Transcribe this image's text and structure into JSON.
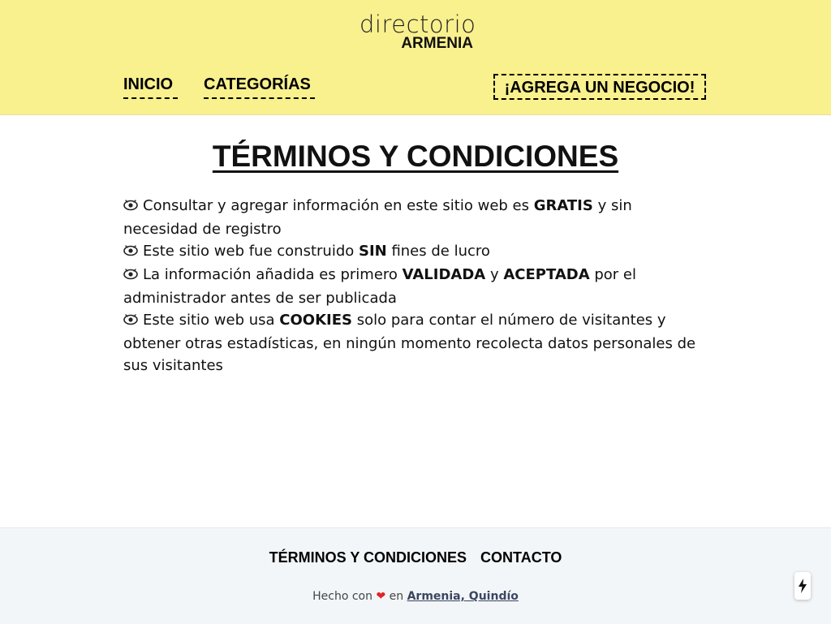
{
  "header": {
    "logo": {
      "top": "directorio",
      "bottom": "ARMENIA"
    },
    "nav": {
      "inicio": "INICIO",
      "categorias": "CATEGORÍAS"
    },
    "cta": "¡AGREGA UN NEGOCIO!",
    "background_color": "#f9f08e"
  },
  "main": {
    "title": "TÉRMINOS Y CONDICIONES",
    "items": [
      {
        "parts": [
          {
            "text": "Consultar y agregar información en este sitio web es ",
            "bold": false
          },
          {
            "text": "GRATIS",
            "bold": true
          },
          {
            "text": " y sin necesidad de registro",
            "bold": false
          }
        ]
      },
      {
        "parts": [
          {
            "text": "Este sitio web fue construido ",
            "bold": false
          },
          {
            "text": "SIN",
            "bold": true
          },
          {
            "text": " fines de lucro",
            "bold": false
          }
        ]
      },
      {
        "parts": [
          {
            "text": "La información añadida es primero ",
            "bold": false
          },
          {
            "text": "VALIDADA",
            "bold": true
          },
          {
            "text": " y ",
            "bold": false
          },
          {
            "text": "ACEPTADA",
            "bold": true
          },
          {
            "text": " por el administrador antes de ser publicada",
            "bold": false
          }
        ]
      },
      {
        "parts": [
          {
            "text": "Este sitio web usa ",
            "bold": false
          },
          {
            "text": "COOKIES",
            "bold": true
          },
          {
            "text": " solo para contar el número de visitantes y obtener otras estadísticas, en ningún momento recolecta datos personales de sus visitantes",
            "bold": false
          }
        ]
      }
    ],
    "bullet_icon": "eye-icon"
  },
  "footer": {
    "links": {
      "terms": "TÉRMINOS Y CONDICIONES",
      "contact": "CONTACTO"
    },
    "made_with": {
      "prefix": "Hecho con",
      "heart": "❤",
      "in": "en",
      "place": "Armenia, Quindío"
    },
    "background_color": "#f3f6f9"
  },
  "widgets": {
    "bolt_icon": "lightning-icon"
  }
}
